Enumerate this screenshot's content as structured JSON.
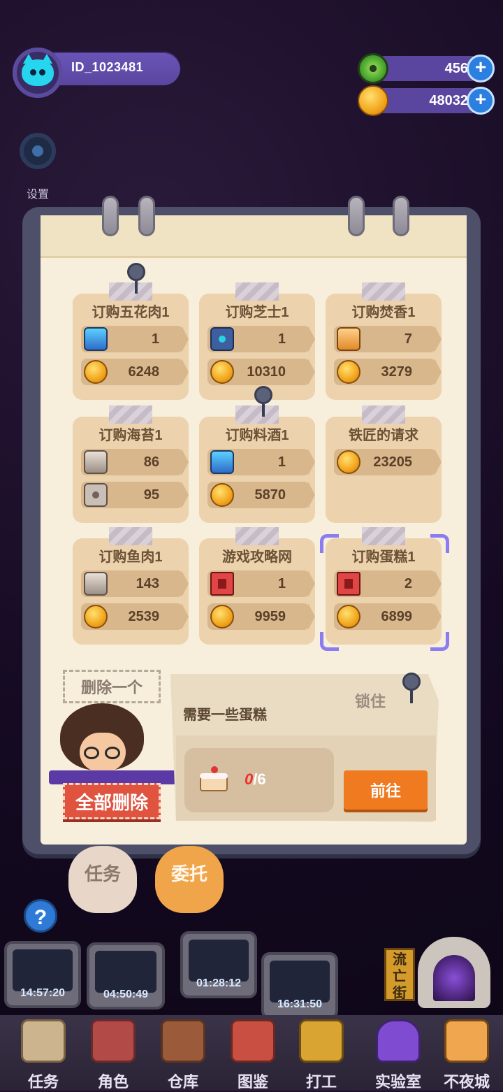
{
  "player": {
    "id": "ID_1023481"
  },
  "currencies": [
    {
      "name": "gem",
      "value": "456"
    },
    {
      "name": "coin",
      "value": "48032"
    }
  ],
  "settings": {
    "label": "设置"
  },
  "orders": [
    {
      "title": "订购五花肉1",
      "rows": [
        {
          "icon": "blue-bolt-icon",
          "value": "1"
        },
        {
          "icon": "coin-icon",
          "value": "6248"
        }
      ]
    },
    {
      "title": "订购芝士1",
      "rows": [
        {
          "icon": "blue-nut-icon",
          "value": "1"
        },
        {
          "icon": "coin-icon",
          "value": "10310"
        }
      ]
    },
    {
      "title": "订购焚香1",
      "rows": [
        {
          "icon": "orange-bolt-icon",
          "value": "7"
        },
        {
          "icon": "coin-icon",
          "value": "3279"
        }
      ]
    },
    {
      "title": "订购海苔1",
      "rows": [
        {
          "icon": "grey-bolt-icon",
          "value": "86"
        },
        {
          "icon": "grey-nut-icon",
          "value": "95"
        }
      ]
    },
    {
      "title": "订购料酒1",
      "rows": [
        {
          "icon": "blue-bolt-icon",
          "value": "1"
        },
        {
          "icon": "coin-icon",
          "value": "5870"
        }
      ]
    },
    {
      "title": "铁匠的请求",
      "rows": [
        {
          "icon": "coin-icon",
          "value": "23205"
        }
      ]
    },
    {
      "title": "订购鱼肉1",
      "rows": [
        {
          "icon": "grey-bolt-icon",
          "value": "143"
        },
        {
          "icon": "coin-icon",
          "value": "2539"
        }
      ]
    },
    {
      "title": "游戏攻略网",
      "rows": [
        {
          "icon": "red-book-icon",
          "value": "1"
        },
        {
          "icon": "coin-icon",
          "value": "9959"
        }
      ]
    },
    {
      "title": "订购蛋糕1",
      "rows": [
        {
          "icon": "red-book-icon",
          "value": "2"
        },
        {
          "icon": "coin-icon",
          "value": "6899"
        }
      ]
    }
  ],
  "actions": {
    "delete_one": "删除一个",
    "delete_all": "全部删除"
  },
  "detail": {
    "lock_label": "锁住",
    "need_text": "需要一些蛋糕",
    "progress_current": "0",
    "progress_total": "/6",
    "go_label": "前往"
  },
  "tabs": {
    "task": "任务",
    "commission": "委托"
  },
  "timers": [
    "14:57:20",
    "04:50:49",
    "01:28:12",
    "16:31:50"
  ],
  "street_sign": "流亡街",
  "nav": [
    "任务",
    "角色",
    "仓库",
    "图鉴",
    "打工",
    "实验室",
    "不夜城"
  ],
  "colors": {
    "accent_orange": "#ef7a1f",
    "delete_red": "#e0533f",
    "selection_purple": "#8b7cf2",
    "currency_pill": "#5a469f"
  }
}
